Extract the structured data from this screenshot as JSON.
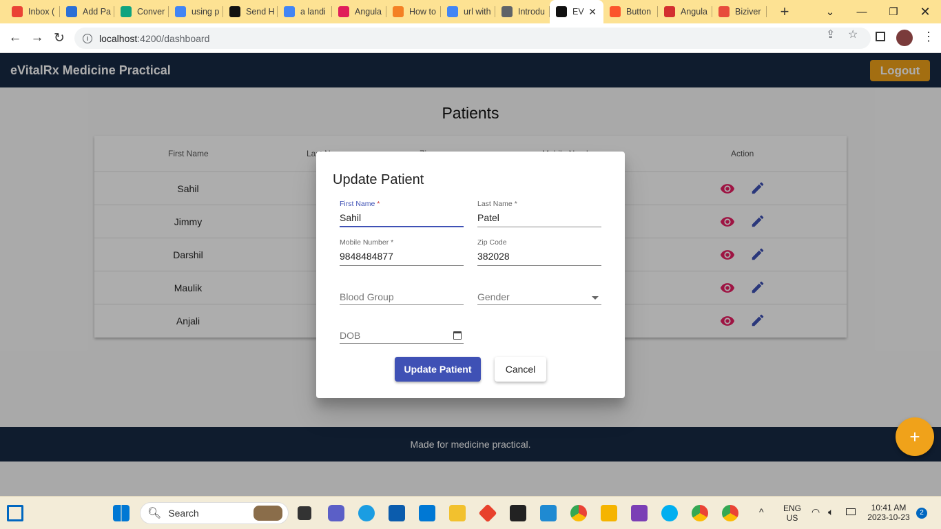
{
  "browser": {
    "tabs": [
      {
        "label": "Inbox (",
        "icon": "gmail-icon",
        "color": "#ea4335"
      },
      {
        "label": "Add Pa",
        "icon": "malwarebytes-icon",
        "color": "#2b6fd6"
      },
      {
        "label": "Conver",
        "icon": "chatgpt-icon",
        "color": "#10a37f"
      },
      {
        "label": "using p",
        "icon": "google-icon",
        "color": "#4285f4"
      },
      {
        "label": "Send H",
        "icon": "medium-icon",
        "color": "#111111"
      },
      {
        "label": "a landi",
        "icon": "google-icon",
        "color": "#4285f4"
      },
      {
        "label": "Angula",
        "icon": "slack-icon",
        "color": "#e01e5a"
      },
      {
        "label": "How to",
        "icon": "stackoverflow-icon",
        "color": "#f48024"
      },
      {
        "label": "url with",
        "icon": "google-icon",
        "color": "#4285f4"
      },
      {
        "label": "Introdu",
        "icon": "code-icon",
        "color": "#5f6368"
      },
      {
        "label": "EV",
        "icon": "angular-icon",
        "color": "#111111",
        "active": true
      },
      {
        "label": "Button",
        "icon": "brave-icon",
        "color": "#fb542b"
      },
      {
        "label": "Angula",
        "icon": "c-icon",
        "color": "#d32f2f"
      },
      {
        "label": "Biziver",
        "icon": "bizivers-icon",
        "color": "#e74c3c"
      }
    ],
    "url_host": "localhost",
    "url_path": ":4200/dashboard"
  },
  "app": {
    "title": "eVitalRx Medicine Practical",
    "logout_label": "Logout",
    "heading": "Patients",
    "footer": "Made for medicine practical.",
    "fab_label": "+",
    "accent_color": "#f0a21a",
    "header_color": "#172a45"
  },
  "table": {
    "headers": [
      "First Name",
      "Last N",
      "Zip c",
      "Mobile Numb",
      "Action"
    ],
    "rows": [
      {
        "first_name": "Sahil"
      },
      {
        "first_name": "Jimmy"
      },
      {
        "first_name": "Darshil"
      },
      {
        "first_name": "Maulik"
      },
      {
        "first_name": "Anjali"
      }
    ]
  },
  "dialog": {
    "title": "Update Patient",
    "first_name": {
      "label": "First Name",
      "value": "Sahil"
    },
    "last_name": {
      "label": "Last Name",
      "value": "Patel"
    },
    "mobile": {
      "label": "Mobile Number",
      "value": "9848484877"
    },
    "zip": {
      "label": "Zip Code",
      "value": "382028"
    },
    "blood_group": {
      "placeholder": "Blood Group"
    },
    "gender": {
      "placeholder": "Gender"
    },
    "dob": {
      "placeholder": "DOB"
    },
    "update_label": "Update Patient",
    "cancel_label": "Cancel",
    "primary_color": "#3f51b5"
  },
  "taskbar": {
    "search_label": "Search",
    "lang_top": "ENG",
    "lang_bottom": "US",
    "time": "10:41 AM",
    "date": "2023-10-23",
    "notifications": "2"
  }
}
